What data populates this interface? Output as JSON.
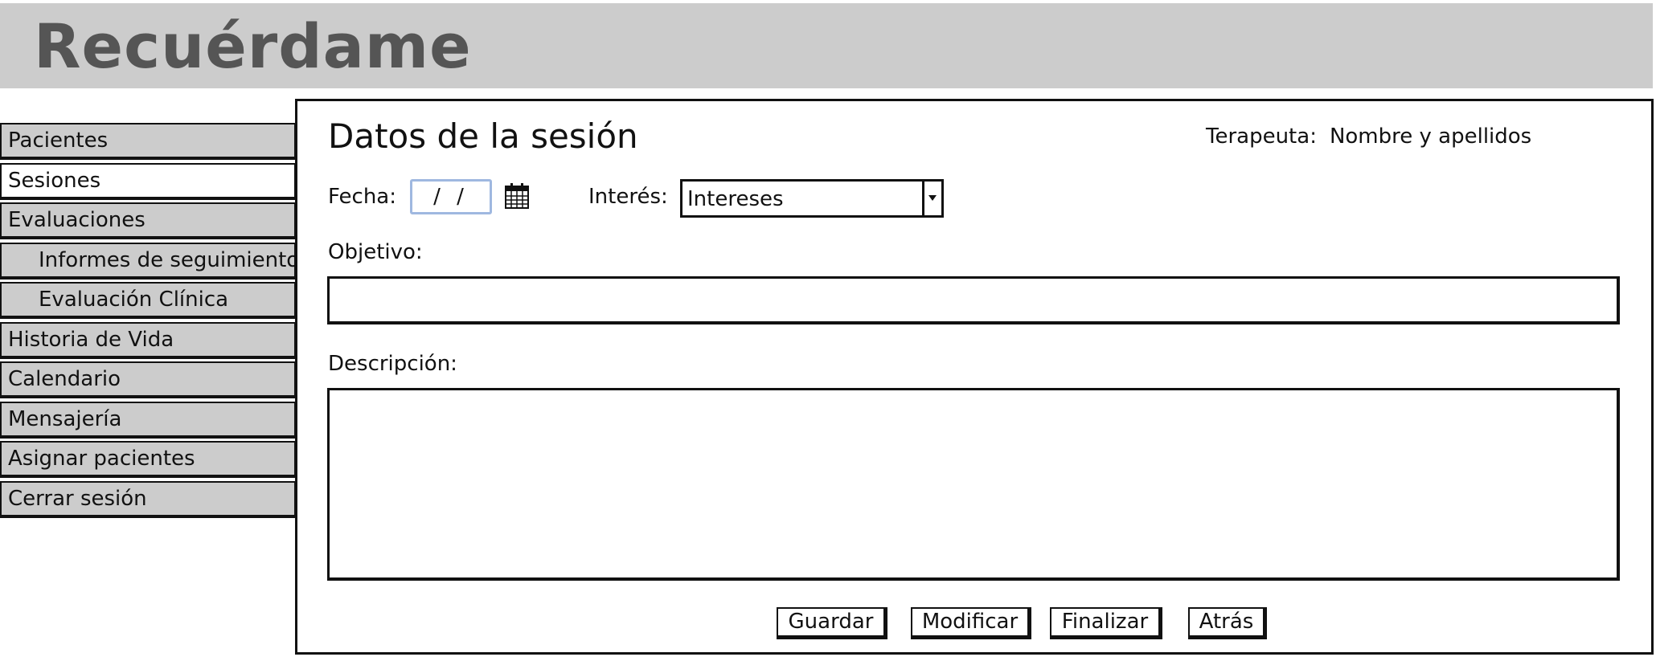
{
  "app": {
    "title": "Recuérdame"
  },
  "sidebar": {
    "items": [
      {
        "label": "Pacientes"
      },
      {
        "label": "Sesiones"
      },
      {
        "label": "Evaluaciones"
      },
      {
        "label": "Informes de seguimiento"
      },
      {
        "label": "Evaluación Clínica"
      },
      {
        "label": "Historia de Vida"
      },
      {
        "label": "Calendario"
      },
      {
        "label": "Mensajería"
      },
      {
        "label": "Asignar pacientes"
      },
      {
        "label": "Cerrar sesión"
      }
    ],
    "active": "Sesiones"
  },
  "main": {
    "title": "Datos de la sesión",
    "therapist_label": "Terapeuta:",
    "therapist_value": "Nombre y apellidos",
    "date_label": "Fecha:",
    "date_value": "/ /",
    "calendar_icon": "calendar-icon",
    "interest_label": "Interés:",
    "interest_value": "Intereses",
    "objective_label": "Objetivo:",
    "objective_value": "",
    "description_label": "Descripción:",
    "description_value": ""
  },
  "actions": {
    "save": "Guardar",
    "modify": "Modificar",
    "finish": "Finalizar",
    "back": "Atrás"
  },
  "colors": {
    "header_bg": "#cccccc",
    "title_color": "#555555",
    "sidebar_bg": "#cccccc",
    "sidebar_active_bg": "#ffffff",
    "date_border": "#9fb8e0"
  }
}
